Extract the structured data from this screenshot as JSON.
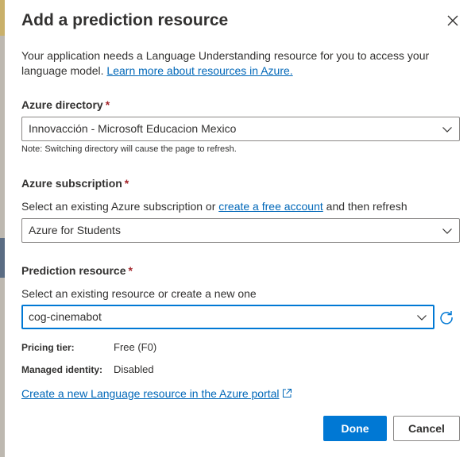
{
  "dialog": {
    "title": "Add a prediction resource",
    "intro_text": "Your application needs a Language Understanding resource for you to access your language model. ",
    "intro_link": "Learn more about resources in Azure."
  },
  "directory": {
    "label": "Azure directory",
    "required_mark": "*",
    "value": "Innovacción - Microsoft Educacion Mexico",
    "note": "Note: Switching directory will cause the page to refresh."
  },
  "subscription": {
    "label": "Azure subscription",
    "required_mark": "*",
    "helper_prefix": "Select an existing Azure subscription or ",
    "helper_link": "create a free account",
    "helper_suffix": " and then refresh",
    "value": "Azure for Students"
  },
  "prediction": {
    "label": "Prediction resource",
    "required_mark": "*",
    "helper": "Select an existing resource or create a new one",
    "value": "cog-cinemabot"
  },
  "details": {
    "pricing_label": "Pricing tier:",
    "pricing_value": "Free (F0)",
    "identity_label": "Managed identity:",
    "identity_value": "Disabled"
  },
  "portal_link": "Create a new Language resource in the Azure portal",
  "buttons": {
    "done": "Done",
    "cancel": "Cancel"
  },
  "colors": {
    "accent": "#0078d4",
    "link": "#0067b8",
    "required": "#a4262c"
  },
  "icons": [
    "close-icon",
    "chevron-down-icon",
    "refresh-icon",
    "external-link-icon"
  ]
}
